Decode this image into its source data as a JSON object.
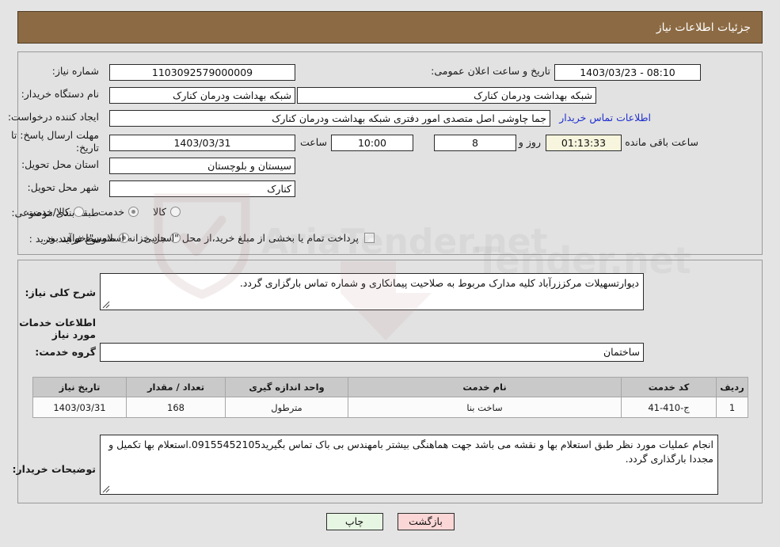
{
  "header": {
    "title": "جزئیات اطلاعات نیاز"
  },
  "top_form": {
    "need_number_label": "شماره نیاز:",
    "need_number_value": "1103092579000009",
    "announce_datetime_label": "تاریخ و ساعت اعلان عمومی:",
    "announce_datetime_value": "08:10 - 1403/03/23",
    "buyer_org_label": "نام دستگاه خریدار:",
    "buyer_org_value": "شبکه بهداشت ودرمان کنارک",
    "buyer_org_value_2": "شبکه بهداشت ودرمان کنارک",
    "creator_label": "ایجاد کننده درخواست:",
    "creator_value": "جما چاوشی اصل متصدی امور دفتری شبکه بهداشت ودرمان کنارک",
    "contact_link": "اطلاعات تماس خریدار",
    "deadline_label": "مهلت ارسال پاسخ: تا تاریخ:",
    "deadline_date": "1403/03/31",
    "deadline_hour_label": "ساعت",
    "deadline_hour": "10:00",
    "remaining_days": "8",
    "remaining_days_label": "روز و",
    "remaining_time": "01:13:33",
    "remaining_time_label": "ساعت باقی مانده",
    "province_label": "استان محل تحویل:",
    "province_value": "سیستان و بلوچستان",
    "city_label": "شهر محل تحویل:",
    "city_value": "کنارک",
    "category_label": "طبقه بندی موضوعی:",
    "category_options": [
      {
        "label": "کالا",
        "selected": false
      },
      {
        "label": "خدمت",
        "selected": true
      },
      {
        "label": "کالا/خدمت",
        "selected": false
      }
    ],
    "process_label": "نوع فرآیند خرید :",
    "process_options": [
      {
        "label": "جزیی",
        "selected": false
      },
      {
        "label": "متوسط",
        "selected": true
      }
    ],
    "treasury_checkbox_label": "پرداخت تمام یا بخشی از مبلغ خرید،از محل \"اسناد خزانه اسلامی\" خواهد بود.",
    "treasury_checked": false
  },
  "bottom_form": {
    "general_desc_label": "شرح کلی نیاز:",
    "general_desc_value": "دیوارتسهیلات مرکززرآباد کلیه مدارک مربوط به صلاحیت پیمانکاری و شماره تماس بارگزاری گردد.",
    "services_section_title": "اطلاعات خدمات مورد نیاز",
    "service_group_label": "گروه خدمت:",
    "service_group_value": "ساختمان",
    "buyer_notes_label": "توضیحات خریدار:",
    "buyer_notes_value": "انجام عملیات مورد نظر طبق استعلام بها و نقشه می باشد جهت هماهنگی بیشتر بامهندس بی باک تماس بگیرید09155452105.استعلام بها تکمیل و مجددا بارگذاری گردد."
  },
  "items_table": {
    "columns": [
      "ردیف",
      "کد خدمت",
      "نام خدمت",
      "واحد اندازه گیری",
      "تعداد / مقدار",
      "تاریخ نیاز"
    ],
    "rows": [
      {
        "radif": "1",
        "code": "ج-410-41",
        "name": "ساخت بنا",
        "unit": "مترطول",
        "qty": "168",
        "date": "1403/03/31"
      }
    ]
  },
  "footer": {
    "print_label": "چاپ",
    "back_label": "بازگشت"
  },
  "colors": {
    "header_bg": "#8c6b44",
    "panel_bg": "#e2e2e2",
    "page_bg": "#e4e4e4",
    "link": "#1f2fd0",
    "timer_bg": "#f7f5dd",
    "table_header_bg": "#c9c9c9",
    "btn_print_bg": "#e7f6e3",
    "btn_back_bg": "#fbd6d6"
  }
}
